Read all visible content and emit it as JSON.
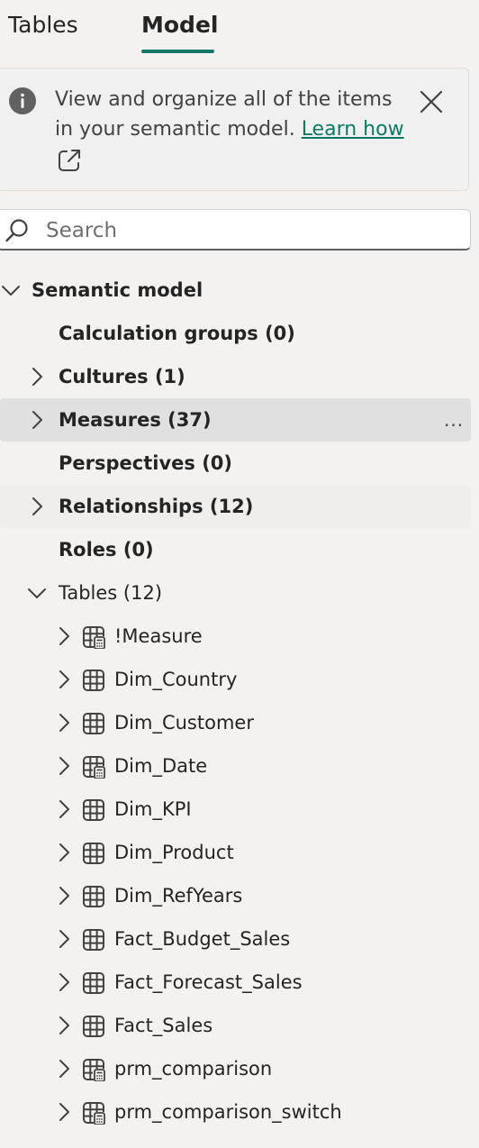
{
  "tabs": [
    {
      "label": "Tables",
      "active": false
    },
    {
      "label": "Model",
      "active": true
    }
  ],
  "colors": {
    "accent": "#117865",
    "row_hover": "#e0e0e0",
    "background": "#f3f2f1"
  },
  "banner": {
    "text": "View and organize all of the items in your semantic model.",
    "link": "Learn how"
  },
  "search": {
    "placeholder": "Search",
    "value": ""
  },
  "tree": {
    "root": {
      "label": "Semantic model",
      "expanded": true
    },
    "sections": [
      {
        "label": "Calculation groups (0)",
        "expandable": false
      },
      {
        "label": "Cultures (1)",
        "expandable": true
      },
      {
        "label": "Measures (37)",
        "expandable": true,
        "more": "..."
      },
      {
        "label": "Perspectives (0)",
        "expandable": false
      },
      {
        "label": "Relationships (12)",
        "expandable": true
      },
      {
        "label": "Roles (0)",
        "expandable": false
      },
      {
        "label": "Tables (12)",
        "expandable": true,
        "expanded": true
      }
    ],
    "tables": [
      {
        "name": "!Measure",
        "icon": "calculated-table-icon"
      },
      {
        "name": "Dim_Country",
        "icon": "table-icon"
      },
      {
        "name": "Dim_Customer",
        "icon": "table-icon"
      },
      {
        "name": "Dim_Date",
        "icon": "calculated-table-icon"
      },
      {
        "name": "Dim_KPI",
        "icon": "table-icon"
      },
      {
        "name": "Dim_Product",
        "icon": "table-icon"
      },
      {
        "name": "Dim_RefYears",
        "icon": "table-icon"
      },
      {
        "name": "Fact_Budget_Sales",
        "icon": "table-icon"
      },
      {
        "name": "Fact_Forecast_Sales",
        "icon": "table-icon"
      },
      {
        "name": "Fact_Sales",
        "icon": "table-icon"
      },
      {
        "name": "prm_comparison",
        "icon": "calculated-table-icon"
      },
      {
        "name": "prm_comparison_switch",
        "icon": "calculated-table-icon"
      }
    ]
  }
}
